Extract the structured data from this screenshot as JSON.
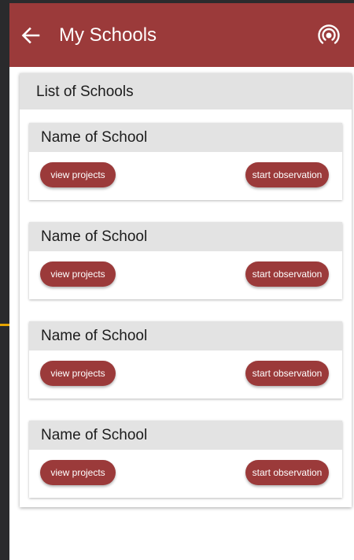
{
  "appbar": {
    "title": "My Schools",
    "back_icon": "arrow-left-icon",
    "action_icon": "radar-icon",
    "color": "#9b3a3a"
  },
  "list": {
    "header": "List of Schools",
    "schools": [
      {
        "name": "Name of School",
        "view_label": "view projects",
        "start_label": "start observation"
      },
      {
        "name": "Name of School",
        "view_label": "view projects",
        "start_label": "start observation"
      },
      {
        "name": "Name of School",
        "view_label": "view projects",
        "start_label": "start observation"
      },
      {
        "name": "Name of School",
        "view_label": "view projects",
        "start_label": "start observation"
      }
    ]
  }
}
